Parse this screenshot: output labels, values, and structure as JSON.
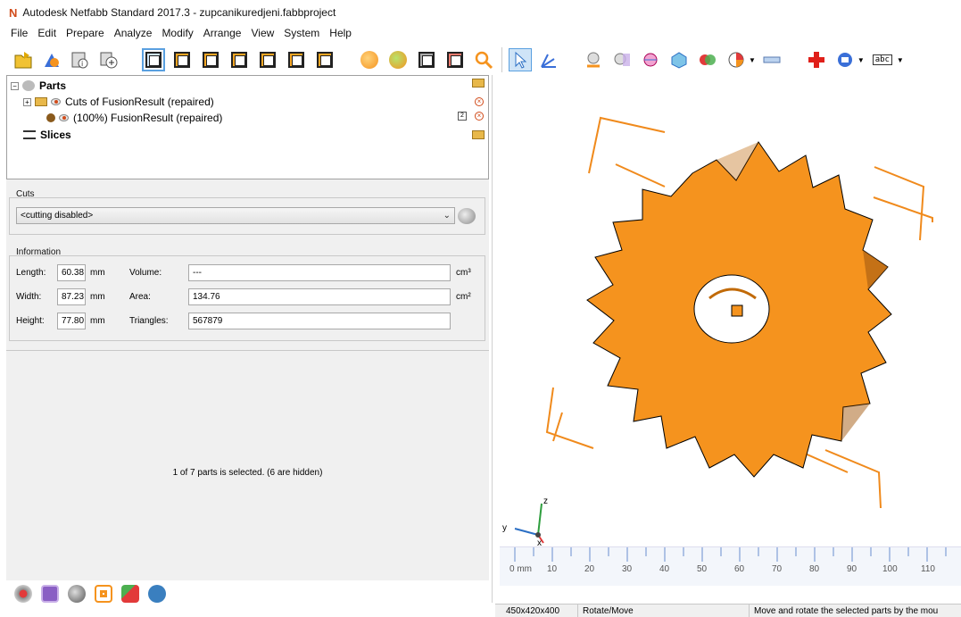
{
  "window": {
    "app_logo": "N",
    "title": "Autodesk Netfabb Standard 2017.3 - zupcanikuredjeni.fabbproject"
  },
  "menu": [
    "File",
    "Edit",
    "Prepare",
    "Analyze",
    "Modify",
    "Arrange",
    "View",
    "System",
    "Help"
  ],
  "toolbar": {
    "buttons": [
      "open-icon",
      "add-part-icon",
      "info-icon",
      "add-icon",
      "view-default-icon",
      "view-front-icon",
      "view-back-icon",
      "view-left-icon",
      "view-right-icon",
      "view-top-icon",
      "view-bottom-icon",
      "shaded-icon",
      "solid-icon",
      "wireframe-icon",
      "clip-icon",
      "zoom-icon",
      "select-icon",
      "measure-icon",
      "repair-icon",
      "cut-icon",
      "slice-icon",
      "merge-icon",
      "boolean-icon",
      "analysis-icon",
      "ruler-icon",
      "red-cross-icon",
      "label-icon",
      "text-label-icon"
    ],
    "text_label": "abc"
  },
  "tree": {
    "root_label": "Parts",
    "items": [
      {
        "label": "Cuts of FusionResult (repaired)"
      },
      {
        "label": "(100%) FusionResult (repaired)",
        "badge": "2"
      }
    ],
    "slices_label": "Slices"
  },
  "cuts": {
    "title": "Cuts",
    "selected": "<cutting disabled>"
  },
  "information": {
    "title": "Information",
    "rows": [
      {
        "label": "Length:",
        "value": "60.38",
        "unit": "mm",
        "field_label": "Volume:",
        "field_value": "---",
        "field_unit": "cm³"
      },
      {
        "label": "Width:",
        "value": "87.23",
        "unit": "mm",
        "field_label": "Area:",
        "field_value": "134.76",
        "field_unit": "cm²"
      },
      {
        "label": "Height:",
        "value": "77.80",
        "unit": "mm",
        "field_label": "Triangles:",
        "field_value": "567879",
        "field_unit": ""
      }
    ]
  },
  "status_message": "1 of 7 parts is selected. (6 are hidden)",
  "viewport": {
    "axes": {
      "z": "z",
      "y": "y",
      "x": "x"
    },
    "ruler_labels": [
      "0 mm",
      "10",
      "20",
      "30",
      "40",
      "50",
      "60",
      "70",
      "80",
      "90",
      "100",
      "110"
    ],
    "colors": {
      "part": "#f5931e",
      "frame": "#f08a1c"
    }
  },
  "statusbar": {
    "dimensions": "450x420x400",
    "mode": "Rotate/Move",
    "hint": "Move and rotate the selected parts by the mou"
  }
}
